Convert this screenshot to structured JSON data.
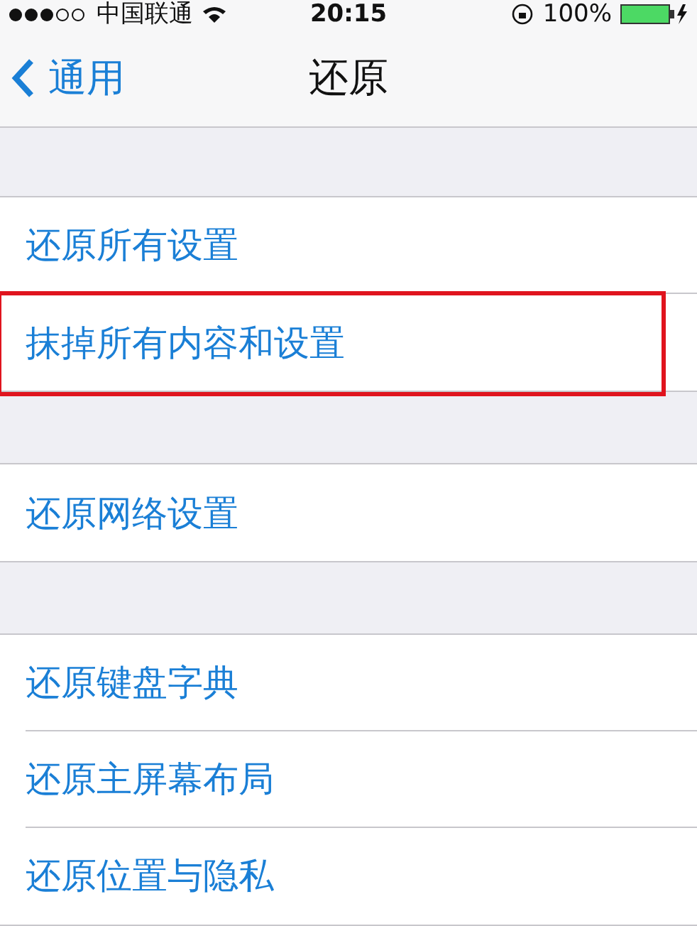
{
  "status_bar": {
    "carrier": "中国联通",
    "time": "20:15",
    "battery": "100%"
  },
  "nav_bar": {
    "back": "通用",
    "title": "还原"
  },
  "groups": [
    {
      "rows": [
        {
          "label": "还原所有设置",
          "highlighted": false
        },
        {
          "label": "抹掉所有内容和设置",
          "highlighted": true
        }
      ]
    },
    {
      "rows": [
        {
          "label": "还原网络设置",
          "highlighted": false
        }
      ]
    },
    {
      "rows": [
        {
          "label": "还原键盘字典",
          "highlighted": false
        },
        {
          "label": "还原主屏幕布局",
          "highlighted": false
        },
        {
          "label": "还原位置与隐私",
          "highlighted": false
        }
      ]
    }
  ]
}
